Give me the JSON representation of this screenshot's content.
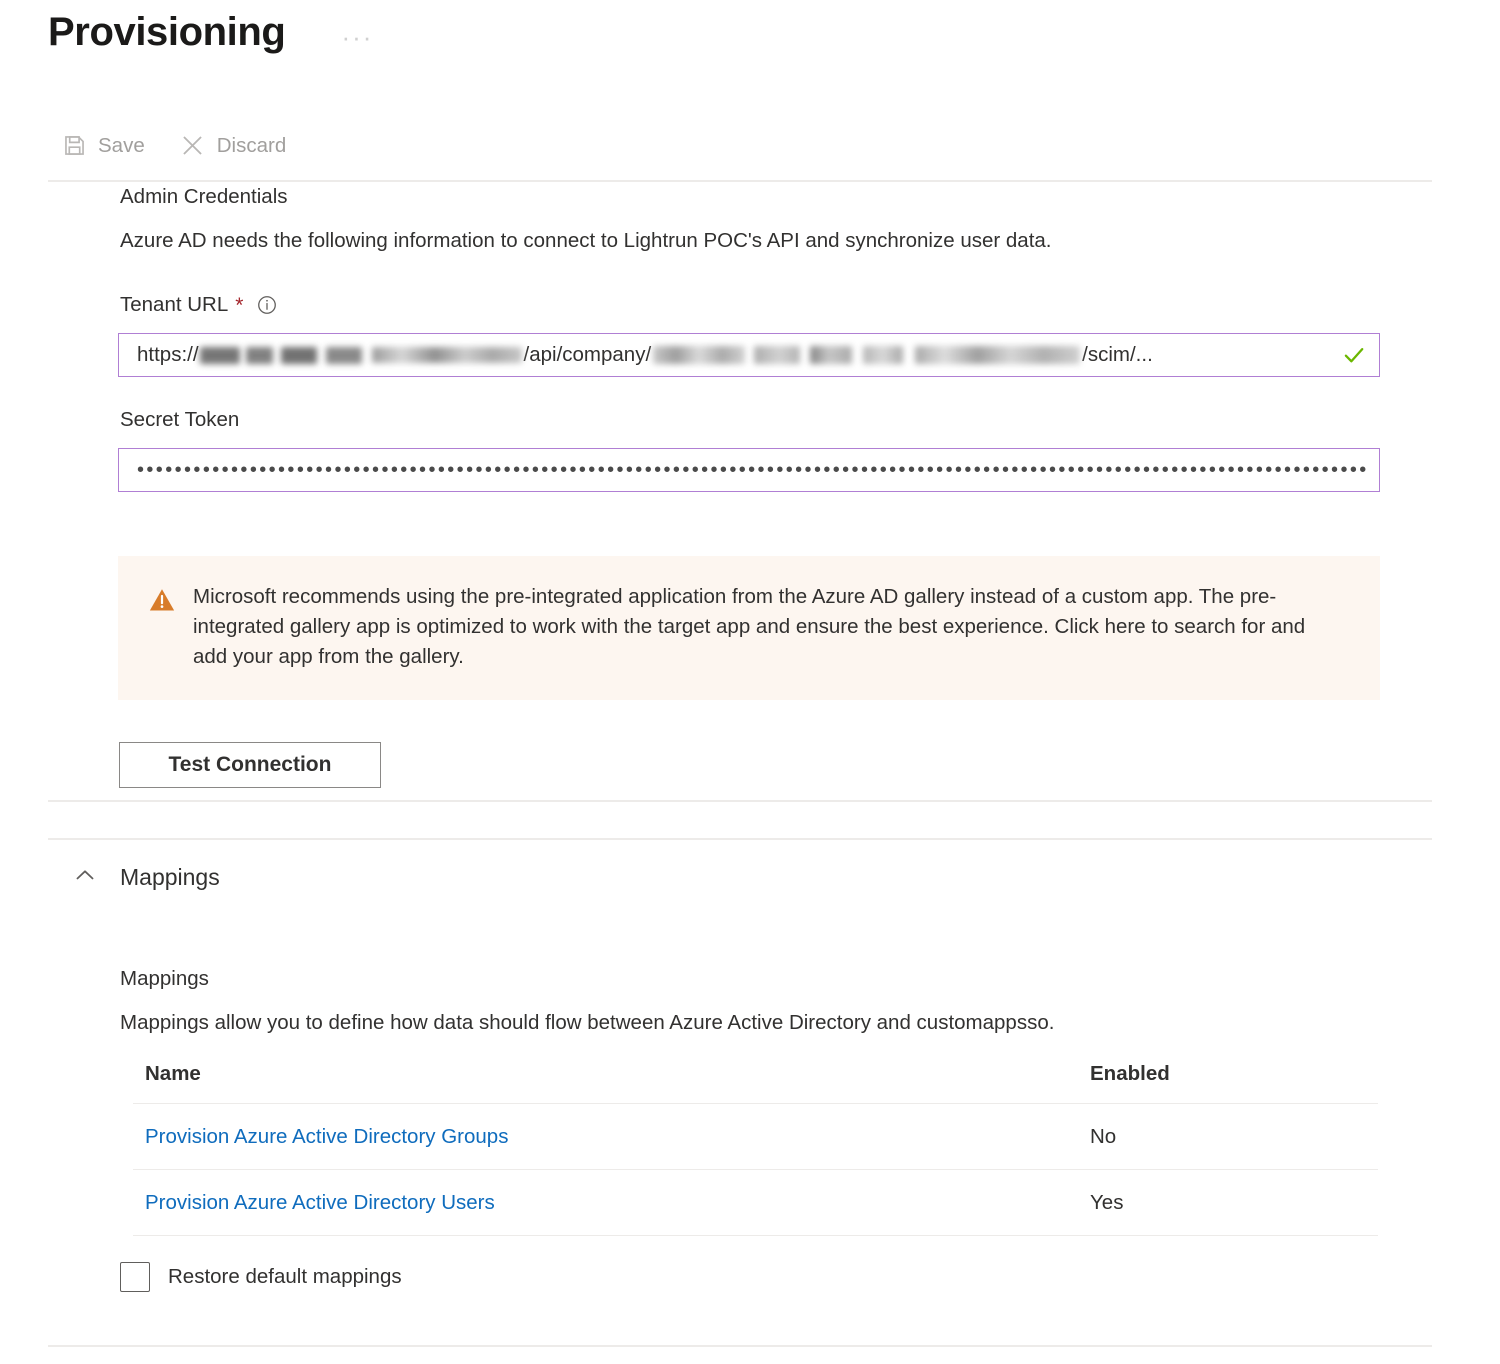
{
  "header": {
    "title": "Provisioning",
    "overflow_menu": "···"
  },
  "command_bar": {
    "save_label": "Save",
    "discard_label": "Discard"
  },
  "admin_credentials": {
    "heading": "Admin Credentials",
    "description": "Azure AD needs the following information to connect to Lightrun POC's API and synchronize user data.",
    "tenant_url": {
      "label": "Tenant URL",
      "required_marker": "*",
      "value_prefix": "https://",
      "value_mid": "/api/company/",
      "value_suffix": "/scim/...",
      "validation_state": "valid"
    },
    "secret_token": {
      "label": "Secret Token",
      "masked_value": "••••••••••••••••••••••••••••••••••••••••••••••••••••••••••••••••••••••••••••••••••••••••••••••••••••••••••••••••••••••••••••••••••••••••••••••••••••..."
    },
    "warning": {
      "text": "Microsoft recommends using the pre-integrated application from the Azure AD gallery instead of a custom app. The pre-integrated gallery app is optimized to work with the target app and ensure the best experience. Click here to search for and add your app from the gallery.",
      "background": "#fdf6f0",
      "icon_color": "#d87c2a"
    },
    "test_connection_label": "Test Connection"
  },
  "mappings_section": {
    "collapse_label": "Mappings",
    "expanded": true,
    "heading": "Mappings",
    "description": "Mappings allow you to define how data should flow between Azure Active Directory and customappsso.",
    "table": {
      "columns": [
        "Name",
        "Enabled"
      ],
      "rows": [
        {
          "name": "Provision Azure Active Directory Groups",
          "enabled": "No"
        },
        {
          "name": "Provision Azure Active Directory Users",
          "enabled": "Yes"
        }
      ]
    },
    "restore_checkbox": {
      "label": "Restore default mappings",
      "checked": false
    }
  },
  "colors": {
    "link": "#0f6cbd",
    "field_border": "#b07fd4",
    "divider": "#edebe9",
    "required": "#a4262c",
    "success": "#6bb700"
  }
}
